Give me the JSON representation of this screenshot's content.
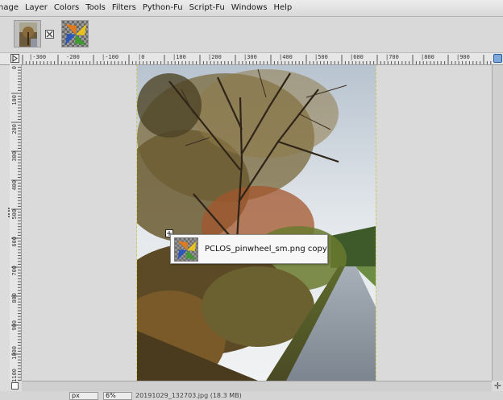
{
  "menubar": {
    "items": [
      "nage",
      "Layer",
      "Colors",
      "Tools",
      "Filters",
      "Python-Fu",
      "Script-Fu",
      "Windows",
      "Help"
    ]
  },
  "tabs": [
    {
      "name": "photo-tab",
      "icon": "tree-photo-thumbnail"
    },
    {
      "name": "pinwheel-tab",
      "icon": "pinwheel-thumbnail"
    }
  ],
  "ruler": {
    "horizontal_labels": [
      "|-300",
      "-200",
      "|-100",
      "|0",
      "|100",
      "|200",
      "|300",
      "|400",
      "|500",
      "|600",
      "|700",
      "|800",
      "|900"
    ],
    "vertical_labels": [
      "0",
      "100",
      "200",
      "300",
      "400",
      "500",
      "600",
      "700",
      "800",
      "900",
      "1000",
      "1100"
    ]
  },
  "tooltip": {
    "label": "PCLOS_pinwheel_sm.png copy",
    "icon": "pinwheel-thumbnail"
  },
  "statusbar": {
    "unit": "px",
    "zoom": "6%",
    "text": "20191029_132703.jpg (18.3 MB)"
  },
  "colors": {
    "pinwheel_yellow": "#e8c21c",
    "pinwheel_green": "#3f9a2f",
    "pinwheel_blue": "#2c56b8",
    "pinwheel_orange": "#e07a1f"
  }
}
